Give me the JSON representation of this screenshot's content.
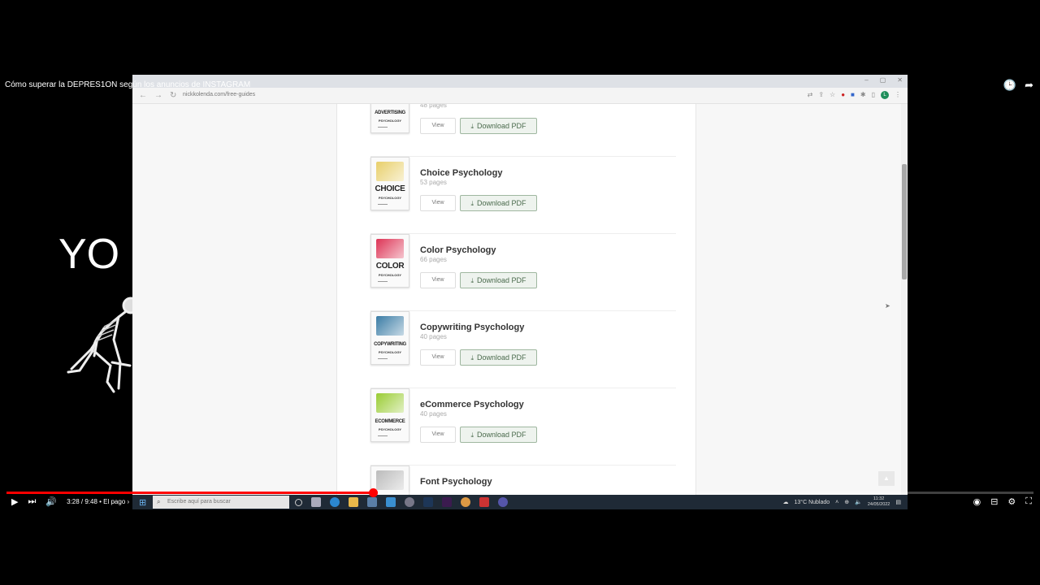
{
  "video": {
    "title": "Cómo superar la DEPRES1ON según los anuncios de INSTAGRAM",
    "overlay_text": "YO",
    "time": "3:28 / 9:48 • El pago ›",
    "progress": 0.357,
    "controls": {
      "play": "▶",
      "next": "⏭",
      "volume": "🔊"
    },
    "right_controls": {
      "autoplay": "◉",
      "subtitles": "⊟",
      "settings": "⚙",
      "fullscreen": "⛶"
    },
    "top_icons": {
      "watch_later": "🕒",
      "share": "➦"
    }
  },
  "browser": {
    "url": "nickkolenda.com/free-guides",
    "nav": {
      "back": "←",
      "forward": "→",
      "reload": "↻"
    },
    "avatar_letter": "L",
    "window_controls": {
      "minimize": "–",
      "maximize": "▢",
      "close": "✕"
    }
  },
  "guides": [
    {
      "title": "",
      "pages": "48 pages",
      "cover_title": "ADVERTISING",
      "cover_sub": "PSYCHOLOGY",
      "cover_color": "#7a6",
      "small": true
    },
    {
      "title": "Choice Psychology",
      "pages": "53 pages",
      "cover_title": "CHOICE",
      "cover_sub": "PSYCHOLOGY",
      "cover_color": "#e8cf6a",
      "small": false
    },
    {
      "title": "Color Psychology",
      "pages": "66 pages",
      "cover_title": "COLOR",
      "cover_sub": "PSYCHOLOGY",
      "cover_color": "#d35",
      "small": false
    },
    {
      "title": "Copywriting Psychology",
      "pages": "40 pages",
      "cover_title": "COPYWRITING",
      "cover_sub": "PSYCHOLOGY",
      "cover_color": "#3a7ca5",
      "small": true
    },
    {
      "title": "eCommerce Psychology",
      "pages": "40 pages",
      "cover_title": "ECOMMERCE",
      "cover_sub": "PSYCHOLOGY",
      "cover_color": "#9c3",
      "small": true
    },
    {
      "title": "Font Psychology",
      "pages": "",
      "cover_title": "",
      "cover_sub": "",
      "cover_color": "#bbb",
      "small": false
    }
  ],
  "buttons": {
    "view": "View",
    "download": "Download PDF",
    "download_icon": "⤓"
  },
  "taskbar": {
    "search_placeholder": "Escribe aquí para buscar",
    "weather": "13°C  Nublado",
    "time": "11:32",
    "date": "24/05/2022"
  },
  "colors": {
    "accent_red": "#ff0000",
    "download_green": "#4b6b4d",
    "taskbar": "#1f2a36"
  }
}
